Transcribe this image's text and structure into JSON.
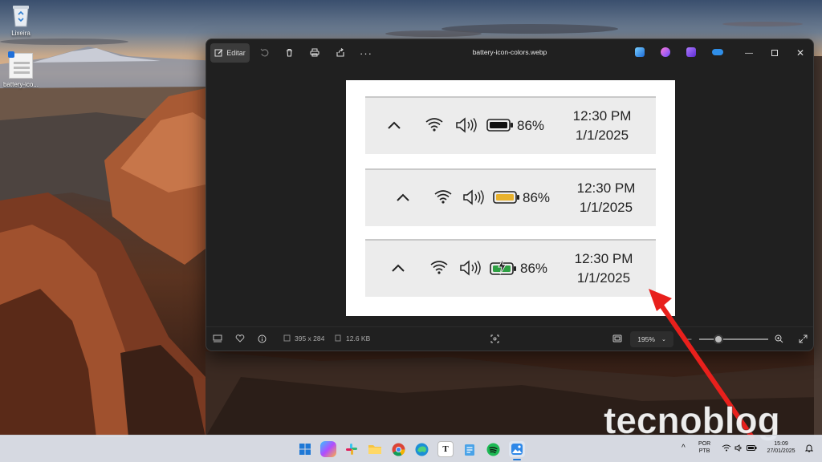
{
  "desktop": {
    "icons": [
      {
        "label": "Lixeira"
      },
      {
        "label": "battery-ico..."
      }
    ]
  },
  "window": {
    "title": "battery-icon-colors.webp",
    "edit_label": "Editar",
    "controls": [
      "minimize-icon",
      "maximize-icon",
      "close-icon"
    ]
  },
  "image": {
    "rows": [
      {
        "percent": "86%",
        "time": "12:30 PM",
        "date": "1/1/2025",
        "battery_color": "#111111",
        "battery_state": "normal"
      },
      {
        "percent": "86%",
        "time": "12:30 PM",
        "date": "1/1/2025",
        "battery_color": "#e8b22e",
        "battery_state": "saver"
      },
      {
        "percent": "86%",
        "time": "12:30 PM",
        "date": "1/1/2025",
        "battery_color": "#2ea043",
        "battery_state": "charging"
      }
    ]
  },
  "statusbar": {
    "dimensions": "395 x 284",
    "filesize": "12.6 KB",
    "zoom": "195%",
    "zoom_slider_level": 0.28
  },
  "watermark": "tecnoblog",
  "taskbar": {
    "apps": [
      "start-icon",
      "copilot-icon",
      "slack-icon",
      "file-explorer-icon",
      "chrome-icon",
      "edge-icon",
      "typora-icon",
      "notepad-icon",
      "spotify-icon",
      "photos-icon"
    ],
    "language_top": "POR",
    "language_bottom": "PTB",
    "time": "15:09",
    "date": "27/01/2025"
  },
  "colors": {
    "accent_red": "#e8201c",
    "window_bg": "#202020",
    "tray_bg": "#ececec"
  }
}
